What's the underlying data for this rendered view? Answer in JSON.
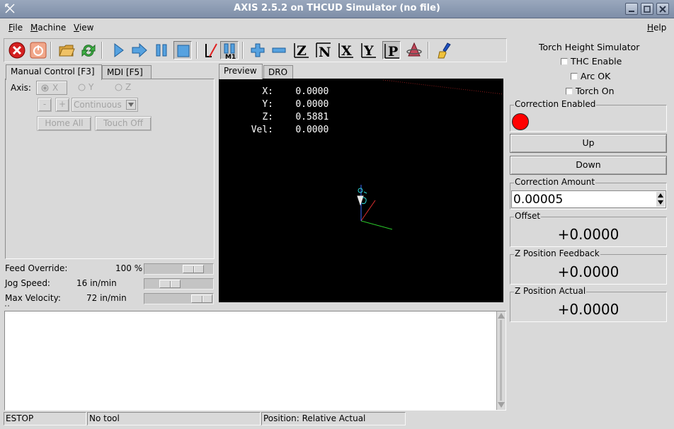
{
  "window": {
    "title": "AXIS 2.5.2 on THCUD Simulator (no file)"
  },
  "menu": {
    "file": "File",
    "machine": "Machine",
    "view": "View",
    "help": "Help"
  },
  "toolbar": {
    "icons": [
      "estop-icon",
      "power-icon",
      "open-file-icon",
      "reload-icon",
      "run-icon",
      "step-icon",
      "pause-icon",
      "stop-icon",
      "optional-block-delete-icon",
      "optional-stop-icon",
      "zoom-in-icon",
      "zoom-out-icon",
      "view-z-icon",
      "view-z-rotated-icon",
      "view-x-icon",
      "view-y-icon",
      "view-perspective-icon",
      "rotate-view-icon",
      "clear-backplot-icon"
    ],
    "active": [
      "optional-stop-icon",
      "view-perspective-icon"
    ]
  },
  "left_tabs": {
    "manual": "Manual Control [F3]",
    "mdi": "MDI [F5]"
  },
  "manual": {
    "axis_label": "Axis:",
    "axes": [
      "X",
      "Y",
      "Z"
    ],
    "minus": "-",
    "plus": "+",
    "jog_mode": "Continuous",
    "home_all": "Home All",
    "touch_off": "Touch Off"
  },
  "sliders": {
    "feed_override_label": "Feed Override:",
    "feed_override_value": "100 %",
    "feed_override_level": 0.82,
    "jog_speed_label": "Jog Speed:",
    "jog_speed_value": "16 in/min",
    "jog_speed_level": 0.3,
    "max_velocity_label": "Max Velocity:",
    "max_velocity_value": "72 in/min",
    "max_velocity_level": 1.0
  },
  "preview_tabs": {
    "preview": "Preview",
    "dro": "DRO"
  },
  "dro": {
    "x_label": "X:",
    "x_value": "0.0000",
    "y_label": "Y:",
    "y_value": "0.0000",
    "z_label": "Z:",
    "z_value": "0.5881",
    "vel_label": "Vel:",
    "vel_value": "0.0000"
  },
  "thc": {
    "title": "Torch Height Simulator",
    "thc_enable": "THC Enable",
    "arc_ok": "Arc OK",
    "torch_on": "Torch On",
    "correction_enabled": "Correction Enabled",
    "indicator_color": "#ff0000",
    "up": "Up",
    "down": "Down",
    "correction_amount_label": "Correction Amount",
    "correction_amount": "0.00005",
    "offset_label": "Offset",
    "offset_value": "+0.0000",
    "z_feedback_label": "Z Position Feedback",
    "z_feedback_value": "+0.0000",
    "z_actual_label": "Z Position Actual",
    "z_actual_value": "+0.0000"
  },
  "status": {
    "estop": "ESTOP",
    "tool": "No tool",
    "position": "Position: Relative Actual"
  }
}
